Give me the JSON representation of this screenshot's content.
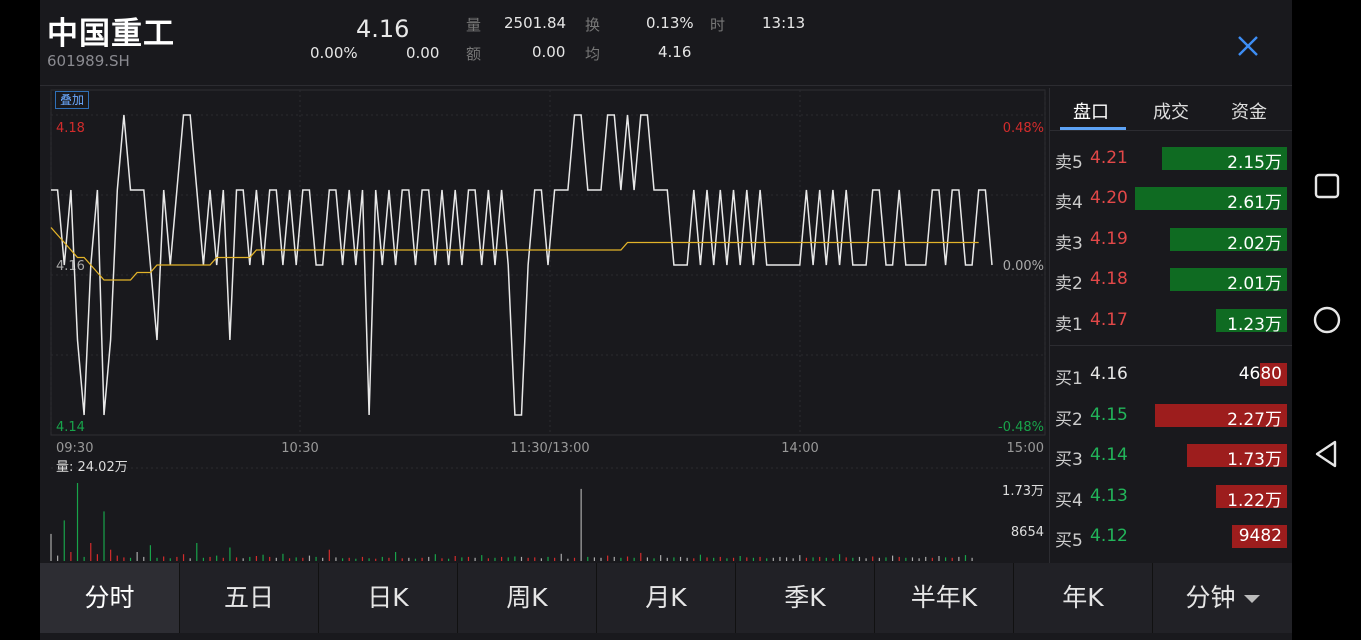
{
  "header": {
    "name": "中国重工",
    "code": "601989.SH",
    "price": "4.16",
    "change_pct": "0.00%",
    "change": "0.00",
    "stats": [
      {
        "label": "量",
        "value": "2501.84"
      },
      {
        "label": "换",
        "value": "0.13%"
      },
      {
        "label": "时",
        "value": "13:13"
      },
      {
        "label": "额",
        "value": "0.00"
      },
      {
        "label": "均",
        "value": "4.16"
      }
    ]
  },
  "chart": {
    "overlay_label": "叠加",
    "price_high": "4.18",
    "price_mid": "4.16",
    "price_low": "4.14",
    "pct_high": "0.48%",
    "pct_mid": "0.00%",
    "pct_low": "-0.48%",
    "time_labels": [
      "09:30",
      "10:30",
      "11:30/13:00",
      "14:00",
      "15:00"
    ],
    "volume_label": "量: 24.02万",
    "volume_max": "1.73万",
    "volume_mid": "8654",
    "colors": {
      "price_line": "#e8e8e8",
      "avg_line": "#e2b329",
      "up": "#d22c2c",
      "down": "#18a34a",
      "neutral": "#aaaaaa"
    }
  },
  "chart_data": {
    "type": "line",
    "title": "",
    "ylim": [
      4.14,
      4.18
    ],
    "x_range": [
      "09:30",
      "15:00"
    ],
    "series": [
      {
        "values": [
          4.17,
          4.17,
          4.16,
          4.17,
          4.15,
          4.14,
          4.16,
          4.17,
          4.14,
          4.15,
          4.17,
          4.18,
          4.17,
          4.17,
          4.17,
          4.16,
          4.15,
          4.17,
          4.16,
          4.17,
          4.18,
          4.18,
          4.17,
          4.16,
          4.17,
          4.16,
          4.17,
          4.15,
          4.17,
          4.17,
          4.16,
          4.17,
          4.16,
          4.17,
          4.17,
          4.16,
          4.17,
          4.16,
          4.17,
          4.17,
          4.16,
          4.16,
          4.17,
          4.17,
          4.16,
          4.17,
          4.16,
          4.17,
          4.14,
          4.17,
          4.16,
          4.17,
          4.16,
          4.17,
          4.17,
          4.16,
          4.17,
          4.17,
          4.16,
          4.17,
          4.16,
          4.17,
          4.16,
          4.17,
          4.17,
          4.16,
          4.17,
          4.16,
          4.17,
          4.16,
          4.14,
          4.14,
          4.16,
          4.17,
          4.17,
          4.16,
          4.17,
          4.17,
          4.17,
          4.18,
          4.18,
          4.17,
          4.17,
          4.17,
          4.18,
          4.18,
          4.17,
          4.18,
          4.17,
          4.18,
          4.18,
          4.17,
          4.17,
          4.17,
          4.16,
          4.16,
          4.16,
          4.17,
          4.16,
          4.17,
          4.16,
          4.17,
          4.16,
          4.17,
          4.16,
          4.17,
          4.16,
          4.17,
          4.16,
          4.16,
          4.16,
          4.16,
          4.16,
          4.16,
          4.17,
          4.16,
          4.17,
          4.16,
          4.17,
          4.16,
          4.17,
          4.16,
          4.16,
          4.16,
          4.17,
          4.17,
          4.16,
          4.16,
          4.17,
          4.16,
          4.16,
          4.16,
          4.16,
          4.17,
          4.17,
          4.16,
          4.17,
          4.17,
          4.16,
          4.16,
          4.17,
          4.17,
          4.16
        ]
      },
      {
        "values": [
          4.165,
          4.164,
          4.163,
          4.162,
          4.161,
          4.161,
          4.16,
          4.159,
          4.158,
          4.158,
          4.158,
          4.158,
          4.158,
          4.159,
          4.159,
          4.159,
          4.16,
          4.16,
          4.16,
          4.16,
          4.16,
          4.16,
          4.16,
          4.16,
          4.16,
          4.161,
          4.161,
          4.161,
          4.161,
          4.161,
          4.161,
          4.162,
          4.162,
          4.162,
          4.162,
          4.162,
          4.162,
          4.162,
          4.162,
          4.162,
          4.162,
          4.162,
          4.162,
          4.162,
          4.162,
          4.162,
          4.162,
          4.162,
          4.162,
          4.162,
          4.162,
          4.162,
          4.162,
          4.162,
          4.162,
          4.162,
          4.162,
          4.162,
          4.162,
          4.162,
          4.162,
          4.162,
          4.162,
          4.162,
          4.162,
          4.162,
          4.162,
          4.162,
          4.162,
          4.162,
          4.162,
          4.162,
          4.162,
          4.162,
          4.162,
          4.162,
          4.162,
          4.162,
          4.162,
          4.162,
          4.162,
          4.162,
          4.162,
          4.162,
          4.162,
          4.162,
          4.162,
          4.163,
          4.163,
          4.163,
          4.163,
          4.163,
          4.163,
          4.163,
          4.163,
          4.163,
          4.163,
          4.163,
          4.163,
          4.163,
          4.163,
          4.163,
          4.163,
          4.163,
          4.163,
          4.163,
          4.163,
          4.163,
          4.163,
          4.163,
          4.163,
          4.163,
          4.163,
          4.163,
          4.163,
          4.163,
          4.163,
          4.163,
          4.163,
          4.163,
          4.163,
          4.163,
          4.163,
          4.163,
          4.163,
          4.163,
          4.163,
          4.163,
          4.163,
          4.163,
          4.163,
          4.163,
          4.163,
          4.163,
          4.163,
          4.163,
          4.163,
          4.163,
          4.163,
          4.163,
          4.163
        ]
      },
      {
        "values": [
          6000,
          1200,
          9000,
          2000,
          17300,
          900,
          4000,
          1500,
          11000,
          2500,
          1200,
          800,
          700,
          2000,
          900,
          3500,
          700,
          1000,
          600,
          900,
          1500,
          600,
          4000,
          700,
          900,
          1200,
          700,
          3000,
          800,
          600,
          900,
          1100,
          1400,
          900,
          700,
          1600,
          600,
          800,
          700,
          1200,
          900,
          700,
          2500,
          800,
          600,
          700,
          500,
          900,
          600,
          500,
          900,
          700,
          2000,
          600,
          700,
          500,
          700,
          900,
          1500,
          600,
          500,
          1100,
          800,
          900,
          700,
          1300,
          600,
          700,
          900,
          800,
          1000,
          900,
          700,
          800,
          600,
          900,
          700,
          1600,
          500,
          700,
          16000,
          900,
          800,
          700,
          1200,
          900,
          700,
          1000,
          700,
          1800,
          800,
          600,
          1300,
          700,
          800,
          900,
          700,
          600,
          1400,
          800,
          700,
          900,
          600,
          700,
          1100,
          800,
          700,
          900,
          600,
          700,
          900,
          800,
          600,
          1300,
          700,
          800,
          900,
          700,
          600,
          1500,
          800,
          700,
          900,
          600,
          1000,
          700,
          800,
          1200,
          900,
          700,
          800,
          600,
          900,
          700,
          1100,
          800,
          700,
          900,
          1300,
          700
        ]
      }
    ]
  },
  "right_tabs": {
    "items": [
      "盘口",
      "成交",
      "资金"
    ],
    "active": 0
  },
  "order_book": {
    "asks": [
      {
        "label": "卖5",
        "price": "4.21",
        "volume": "2.15万",
        "frac": 0.82
      },
      {
        "label": "卖4",
        "price": "4.20",
        "volume": "2.61万",
        "frac": 1.0
      },
      {
        "label": "卖3",
        "price": "4.19",
        "volume": "2.02万",
        "frac": 0.77
      },
      {
        "label": "卖2",
        "price": "4.18",
        "volume": "2.01万",
        "frac": 0.77
      },
      {
        "label": "卖1",
        "price": "4.17",
        "volume": "1.23万",
        "frac": 0.47
      }
    ],
    "bids": [
      {
        "label": "买1",
        "price": "4.16",
        "volume": "4680",
        "frac": 0.18
      },
      {
        "label": "买2",
        "price": "4.15",
        "volume": "2.27万",
        "frac": 0.87
      },
      {
        "label": "买3",
        "price": "4.14",
        "volume": "1.73万",
        "frac": 0.66
      },
      {
        "label": "买4",
        "price": "4.13",
        "volume": "1.22万",
        "frac": 0.47
      },
      {
        "label": "买5",
        "price": "4.12",
        "volume": "9482",
        "frac": 0.36
      }
    ]
  },
  "bottom_tabs": {
    "items": [
      "分时",
      "五日",
      "日K",
      "周K",
      "月K",
      "季K",
      "半年K",
      "年K",
      "分钟"
    ],
    "active": 0
  },
  "navbar": {
    "icons": [
      "square-icon",
      "circle-icon",
      "back-triangle-icon"
    ]
  }
}
